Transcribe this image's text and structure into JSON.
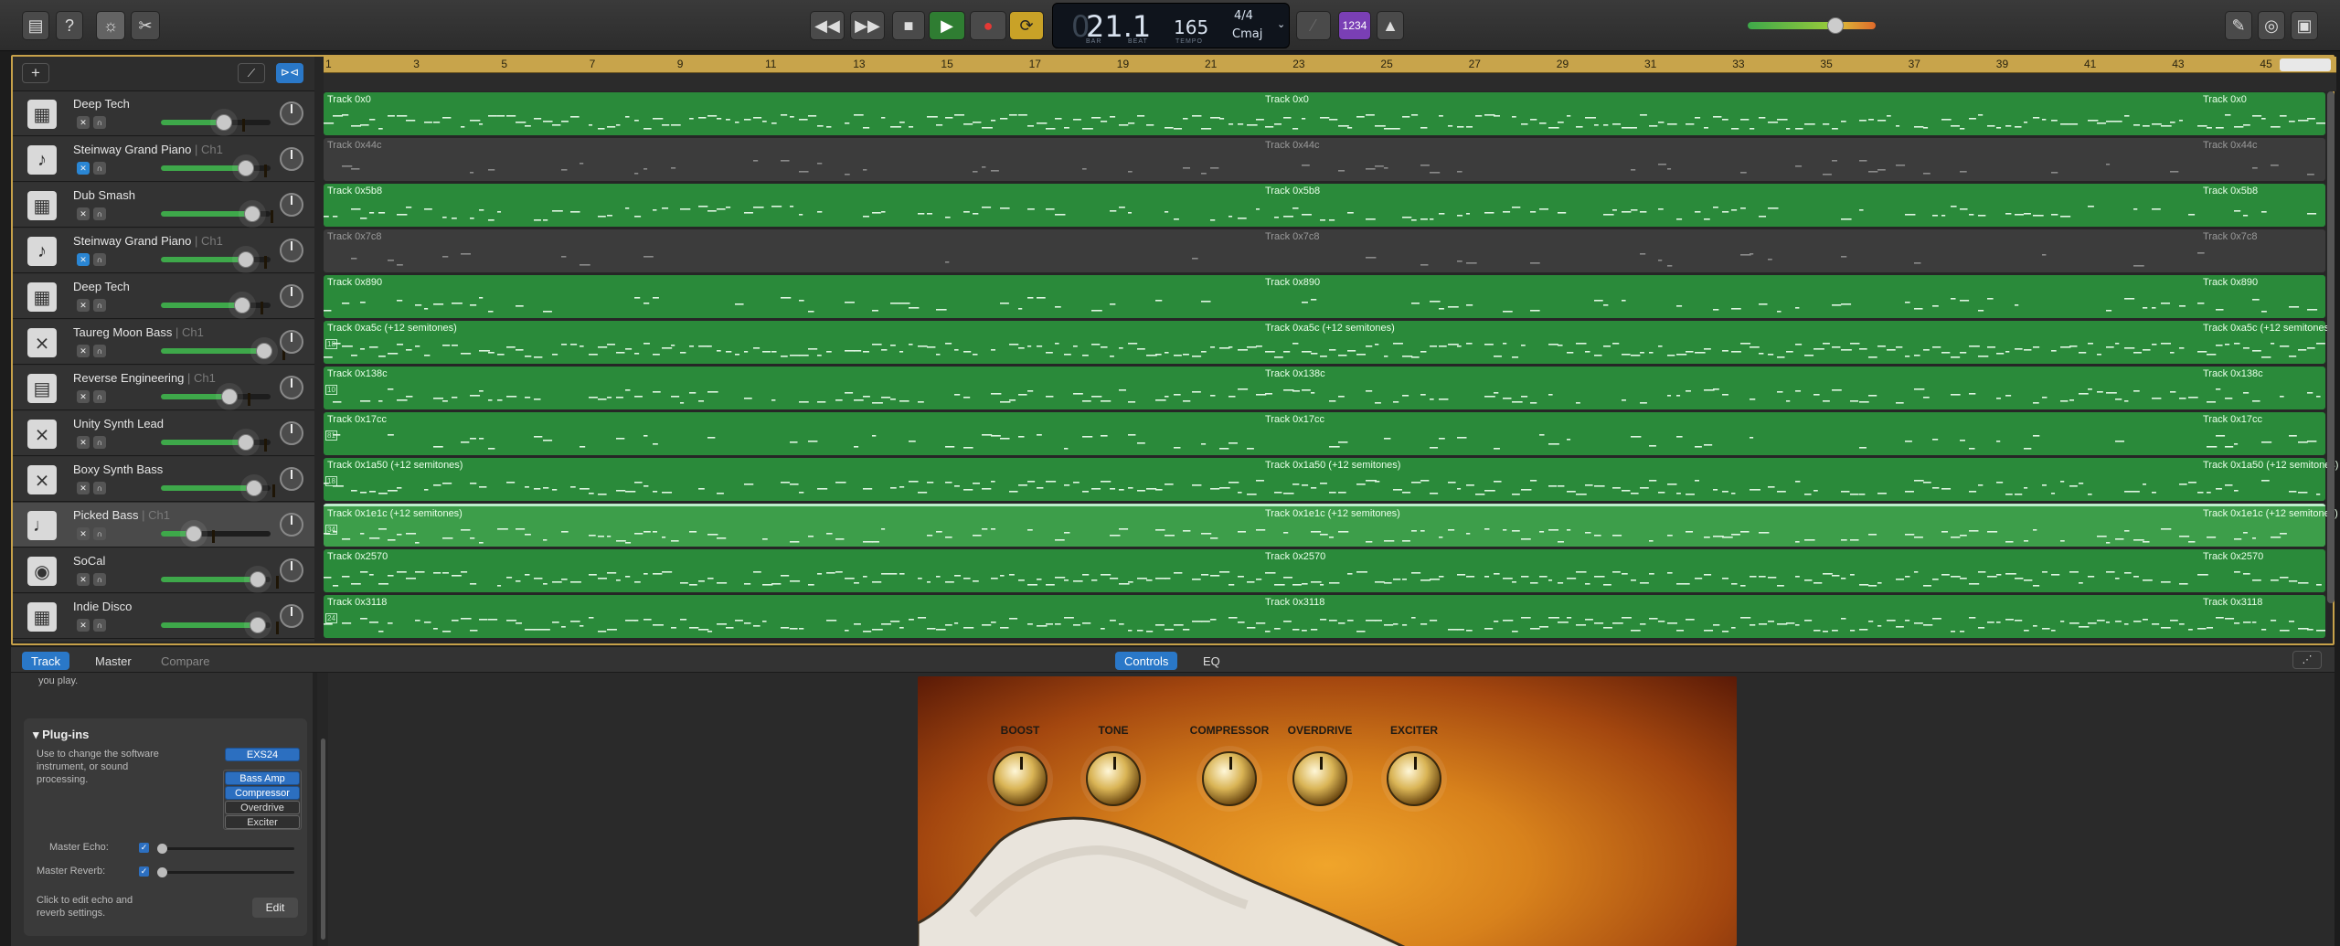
{
  "toolbar": {
    "lcd": {
      "bar": "21.1",
      "bar_label": "BAR",
      "beat_label": "BEAT",
      "tempo": "165",
      "tempo_label": "TEMPO",
      "time_sig": "4/4",
      "key": "Cmaj"
    },
    "count_in": "1234",
    "colors": {
      "play": "#2f7d32",
      "record": "#d33",
      "cycle": "#c9a227",
      "count_in": "#7a3fb5"
    }
  },
  "ruler": {
    "bars": [
      "1",
      "3",
      "5",
      "7",
      "9",
      "11",
      "13",
      "15",
      "17",
      "19",
      "21",
      "23",
      "25",
      "27",
      "29",
      "31",
      "33",
      "35",
      "37",
      "39",
      "41",
      "43",
      "45"
    ]
  },
  "tracks": [
    {
      "name": "Deep Tech",
      "channel": "",
      "icon": "drum-machine-icon",
      "region": "Track 0x0",
      "lane": "green",
      "volume": 0.6
    },
    {
      "name": "Steinway Grand Piano",
      "channel": "| Ch1",
      "icon": "piano-icon",
      "region": "Track 0x44c",
      "lane": "dark",
      "volume": 0.82
    },
    {
      "name": "Dub Smash",
      "channel": "",
      "icon": "drum-machine-icon",
      "region": "Track 0x5b8",
      "lane": "green",
      "volume": 0.88
    },
    {
      "name": "Steinway Grand Piano",
      "channel": "| Ch1",
      "icon": "piano-icon",
      "region": "Track 0x7c8",
      "lane": "dark",
      "volume": 0.82
    },
    {
      "name": "Deep Tech",
      "channel": "",
      "icon": "drum-machine-icon",
      "region": "Track 0x890",
      "lane": "green",
      "volume": 0.78
    },
    {
      "name": "Taureg Moon Bass",
      "channel": "| Ch1",
      "icon": "synth-icon",
      "region": "Track 0xa5c (+12 semitones)",
      "lane": "green",
      "volume": 1.0
    },
    {
      "name": "Reverse Engineering",
      "channel": "| Ch1",
      "icon": "keyboard-icon",
      "region": "Track 0x138c",
      "lane": "green",
      "volume": 0.65
    },
    {
      "name": "Unity Synth Lead",
      "channel": "",
      "icon": "synth-icon",
      "region": "Track 0x17cc",
      "lane": "green",
      "volume": 0.82
    },
    {
      "name": "Boxy Synth Bass",
      "channel": "",
      "icon": "synth-icon",
      "region": "Track 0x1a50 (+12 semitones)",
      "lane": "green",
      "volume": 0.9
    },
    {
      "name": "Picked Bass",
      "channel": "| Ch1",
      "icon": "bass-guitar-icon",
      "region": "Track 0x1e1c (+12 semitones)",
      "lane": "selected",
      "volume": 0.3
    },
    {
      "name": "SoCal",
      "channel": "",
      "icon": "drum-kit-icon",
      "region": "Track 0x2570",
      "lane": "green",
      "volume": 0.94
    },
    {
      "name": "Indie Disco",
      "channel": "",
      "icon": "drum-machine-icon",
      "region": "Track 0x3118",
      "lane": "green",
      "volume": 0.94
    }
  ],
  "lane_badges": [
    "",
    "",
    "",
    "",
    "",
    "18",
    "10",
    "81",
    "18",
    "34",
    "",
    "24"
  ],
  "bottom_tabs": {
    "track": "Track",
    "master": "Master",
    "compare": "Compare",
    "controls": "Controls",
    "eq": "EQ"
  },
  "inspector": {
    "top_text": "you play.",
    "plugins_title": "Plug-ins",
    "plugins_desc": "Use to change the software instrument, or sound processing.",
    "plugins": [
      "EXS24",
      "Bass Amp",
      "Compressor",
      "Overdrive",
      "Exciter"
    ],
    "master_echo": "Master Echo:",
    "master_reverb": "Master Reverb:",
    "edit_desc": "Click to edit echo and reverb settings.",
    "edit_button": "Edit"
  },
  "amp": {
    "knobs": [
      "BOOST",
      "TONE",
      "COMPRESSOR",
      "OVERDRIVE",
      "EXCITER"
    ]
  }
}
